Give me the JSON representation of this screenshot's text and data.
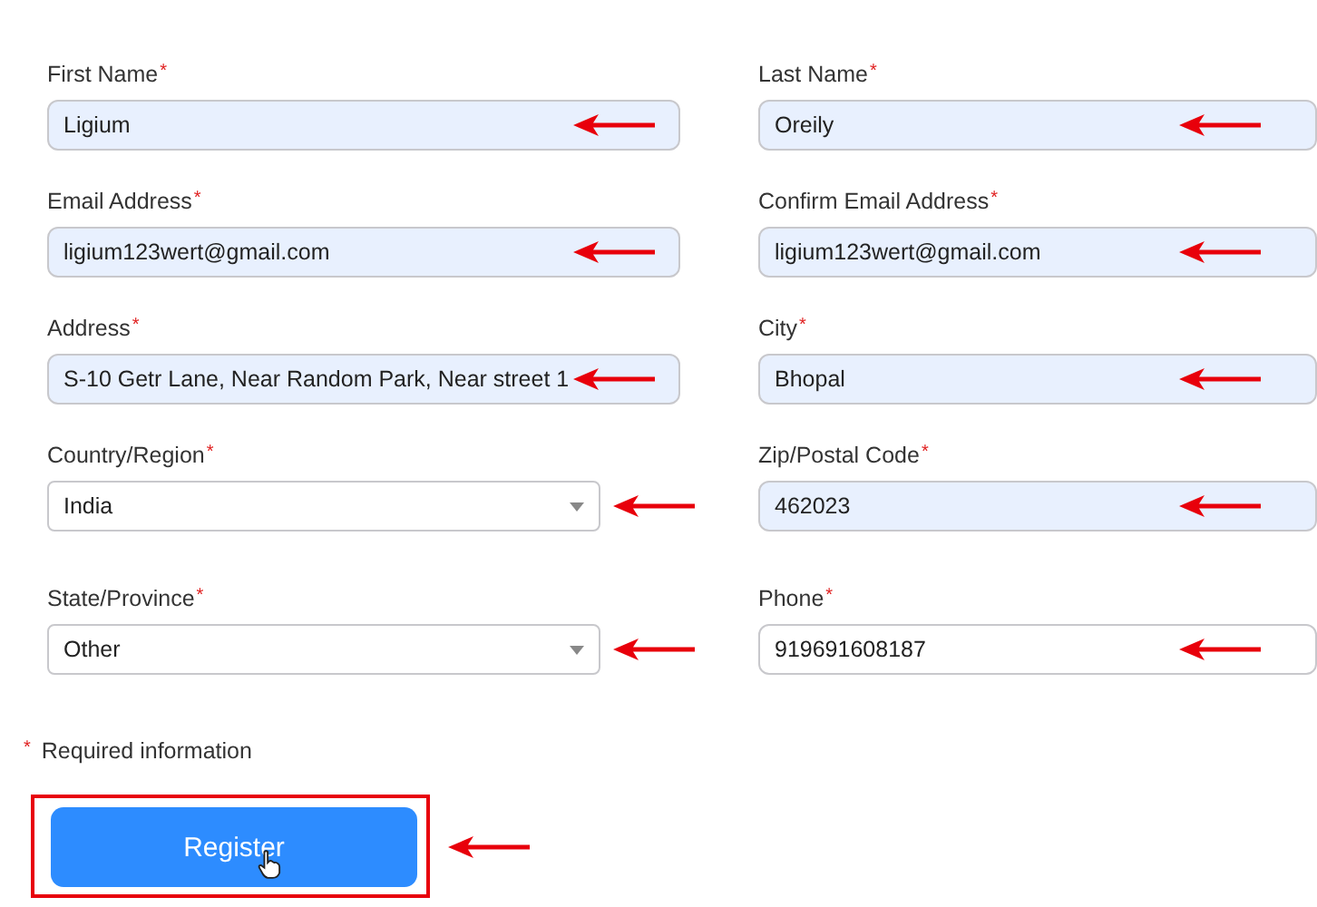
{
  "fields": [
    {
      "label": "First Name",
      "required_mark": "*",
      "kind": "text",
      "value": "Ligium",
      "autofilled": true,
      "annotated": true
    },
    {
      "label": "Last Name",
      "required_mark": "*",
      "kind": "text",
      "value": "Oreily",
      "autofilled": true,
      "annotated": true
    },
    {
      "label": "Email Address",
      "required_mark": "*",
      "kind": "text",
      "value": "ligium123wert@gmail.com",
      "autofilled": true,
      "annotated": true
    },
    {
      "label": "Confirm Email Address",
      "required_mark": "*",
      "kind": "text",
      "value": "ligium123wert@gmail.com",
      "autofilled": true,
      "annotated": true
    },
    {
      "label": "Address",
      "required_mark": "*",
      "kind": "text",
      "value": "S-10 Getr Lane, Near Random Park, Near street 1",
      "autofilled": true,
      "annotated": true
    },
    {
      "label": "City",
      "required_mark": "*",
      "kind": "text",
      "value": "Bhopal",
      "autofilled": true,
      "annotated": true
    },
    {
      "label": "Country/Region",
      "required_mark": "*",
      "kind": "select",
      "value": "India",
      "autofilled": false,
      "annotated": true
    },
    {
      "label": "Zip/Postal Code",
      "required_mark": "*",
      "kind": "text",
      "value": "462023",
      "autofilled": true,
      "annotated": true
    },
    {
      "label": "State/Province",
      "required_mark": "*",
      "kind": "select",
      "value": "Other",
      "autofilled": false,
      "annotated": true
    },
    {
      "label": "Phone",
      "required_mark": "*",
      "kind": "text",
      "value": "919691608187",
      "autofilled": false,
      "annotated": true
    }
  ],
  "required_note": {
    "mark": "*",
    "text": "Required information"
  },
  "register_button": {
    "label": "Register",
    "highlighted": true,
    "annotated": true,
    "hovered": true
  }
}
